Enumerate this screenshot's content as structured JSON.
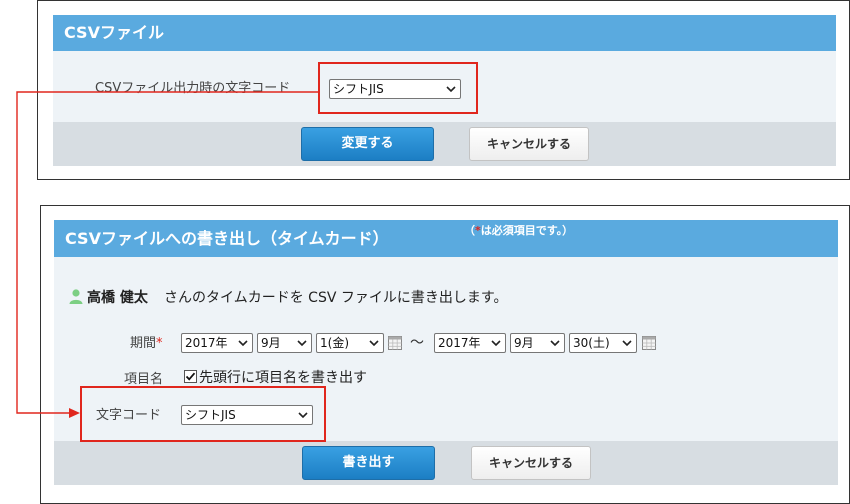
{
  "panel1": {
    "title": "CSVファイル",
    "encoding_label": "CSVファイル出力時の文字コード",
    "encoding_value": "シフトJIS",
    "submit_label": "変更する",
    "cancel_label": "キャンセルする"
  },
  "panel2": {
    "title": "CSVファイルへの書き出し（タイムカード）",
    "required_note_prefix": "（",
    "required_mark": "*",
    "required_note_suffix": "は必須項目です。）",
    "user_name": "高橋 健太",
    "description": "さんのタイムカードを CSV ファイルに書き出します。",
    "period_label": "期間",
    "period_required": "*",
    "from_year": "2017年",
    "from_month": "9月",
    "from_day": "1(金)",
    "tilde": "～",
    "to_year": "2017年",
    "to_month": "9月",
    "to_day": "30(土)",
    "item_name_label": "項目名",
    "checkbox_label": "先頭行に項目名を書き出す",
    "checkbox_checked": true,
    "encoding_label": "文字コード",
    "encoding_value": "シフトJIS",
    "submit_label": "書き出す",
    "cancel_label": "キャンセルする"
  },
  "colors": {
    "header_blue": "#5aaadf",
    "annotation_red": "#e0261d",
    "primary_button": "#1c7ec4",
    "user_icon_green": "#7ccf83"
  }
}
